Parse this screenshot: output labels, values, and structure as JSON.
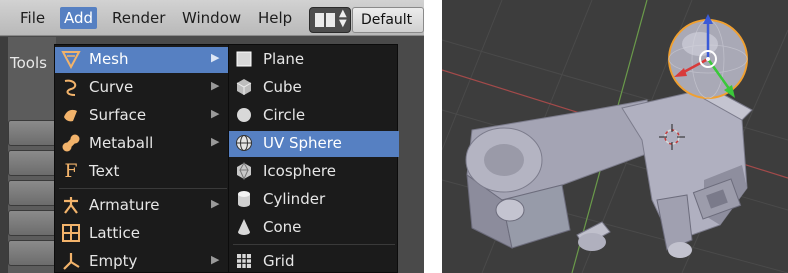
{
  "menubar": {
    "items": [
      "File",
      "Add",
      "Render",
      "Window",
      "Help"
    ],
    "active_index": 1,
    "layout_selector": "Default"
  },
  "tools_panel": {
    "label": "Tools"
  },
  "add_menu": {
    "items": [
      {
        "label": "Mesh",
        "icon": "mesh-icon",
        "has_submenu": true,
        "highlighted": true
      },
      {
        "label": "Curve",
        "icon": "curve-icon",
        "has_submenu": true
      },
      {
        "label": "Surface",
        "icon": "surface-icon",
        "has_submenu": true
      },
      {
        "label": "Metaball",
        "icon": "metaball-icon",
        "has_submenu": true
      },
      {
        "label": "Text",
        "icon": "text-icon",
        "has_submenu": false
      },
      {
        "label": "Armature",
        "icon": "armature-icon",
        "has_submenu": true
      },
      {
        "label": "Lattice",
        "icon": "lattice-icon",
        "has_submenu": false
      },
      {
        "label": "Empty",
        "icon": "empty-icon",
        "has_submenu": true
      }
    ]
  },
  "mesh_submenu": {
    "items": [
      {
        "label": "Plane",
        "icon": "plane-icon"
      },
      {
        "label": "Cube",
        "icon": "cube-icon"
      },
      {
        "label": "Circle",
        "icon": "circle-icon"
      },
      {
        "label": "UV Sphere",
        "icon": "uv-sphere-icon",
        "highlighted": true
      },
      {
        "label": "Icosphere",
        "icon": "icosphere-icon"
      },
      {
        "label": "Cylinder",
        "icon": "cylinder-icon"
      },
      {
        "label": "Cone",
        "icon": "cone-icon"
      },
      {
        "label": "Grid",
        "icon": "grid-icon"
      }
    ]
  },
  "viewport": {
    "objects": [
      "uv-sphere",
      "mechanical-part"
    ],
    "colors": {
      "background": "#3d3d3d",
      "grid": "#4a4a4a",
      "axis_x": "#a34a4a",
      "axis_y": "#6a9a4a",
      "selection_outline": "#f0a030",
      "mesh": "#a7a7b7"
    }
  }
}
